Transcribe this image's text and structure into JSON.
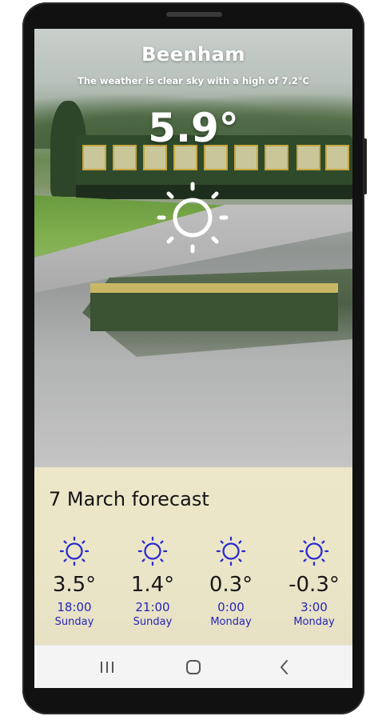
{
  "weather": {
    "city": "Beenham",
    "summary": "The weather is clear sky with a high of 7.2°C",
    "current_temp": "5.9°",
    "current_icon": "sun-icon"
  },
  "forecast": {
    "title": "7 March forecast",
    "icon_color": "#2a2ad0",
    "slots": [
      {
        "temp": "3.5°",
        "time": "18:00",
        "day": "Sunday",
        "icon": "sun-icon"
      },
      {
        "temp": "1.4°",
        "time": "21:00",
        "day": "Sunday",
        "icon": "sun-icon"
      },
      {
        "temp": "0.3°",
        "time": "0:00",
        "day": "Monday",
        "icon": "sun-icon"
      },
      {
        "temp": "-0.3°",
        "time": "3:00",
        "day": "Monday",
        "icon": "sun-icon"
      }
    ]
  },
  "navigation": {
    "recent_apps": "recents-icon",
    "home": "home-icon",
    "back": "back-icon"
  },
  "colors": {
    "accent_blue": "#2424b8",
    "panel_bg": "#ece7c9"
  }
}
